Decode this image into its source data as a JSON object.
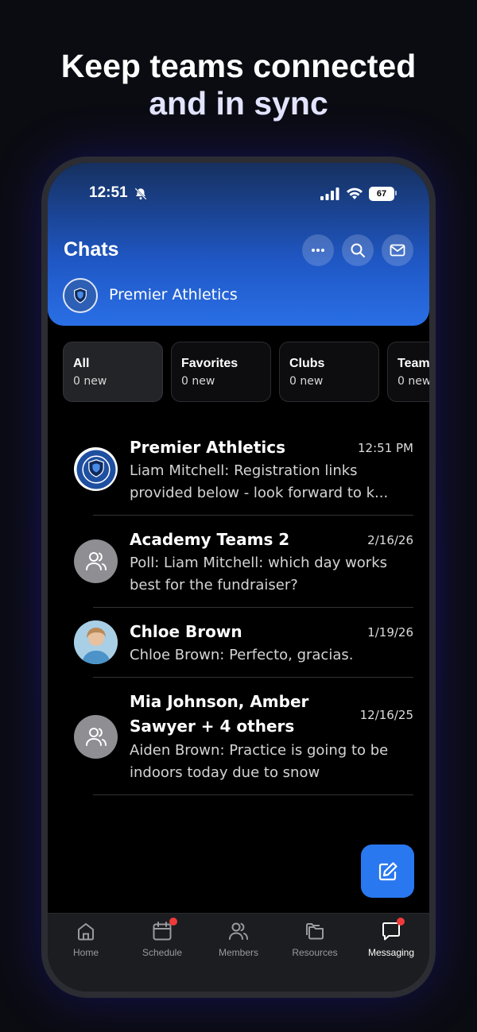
{
  "headline": {
    "line1": "Keep teams connected",
    "line2": "and in sync"
  },
  "status_bar": {
    "time": "12:51",
    "battery": "67"
  },
  "header": {
    "title": "Chats",
    "org_name": "Premier Athletics"
  },
  "tabs": [
    {
      "label": "All",
      "count": "0 new"
    },
    {
      "label": "Favorites",
      "count": "0 new"
    },
    {
      "label": "Clubs",
      "count": "0 new"
    },
    {
      "label": "Team",
      "count": "0 new"
    }
  ],
  "chats": [
    {
      "name": "Premier Athletics",
      "date": "12:51 PM",
      "preview": "Liam Mitchell: Registration links provided below - look forward to k..."
    },
    {
      "name": "Academy Teams 2",
      "date": "2/16/26",
      "preview": "Poll: Liam Mitchell: which day works best for the fundraiser?"
    },
    {
      "name": "Chloe Brown",
      "date": "1/19/26",
      "preview": "Chloe Brown: Perfecto, gracias."
    },
    {
      "name": "Mia Johnson, Amber Sawyer + 4 others",
      "date": "12/16/25",
      "preview": "Aiden Brown: Practice is going to be indoors today due to snow"
    }
  ],
  "nav": [
    {
      "label": "Home",
      "icon": "home-icon"
    },
    {
      "label": "Schedule",
      "icon": "calendar-icon",
      "badge": true
    },
    {
      "label": "Members",
      "icon": "members-icon"
    },
    {
      "label": "Resources",
      "icon": "folders-icon"
    },
    {
      "label": "Messaging",
      "icon": "chat-icon",
      "badge": true,
      "active": true
    }
  ],
  "colors": {
    "accent": "#2a78f0",
    "badge": "#ef3a3a"
  }
}
